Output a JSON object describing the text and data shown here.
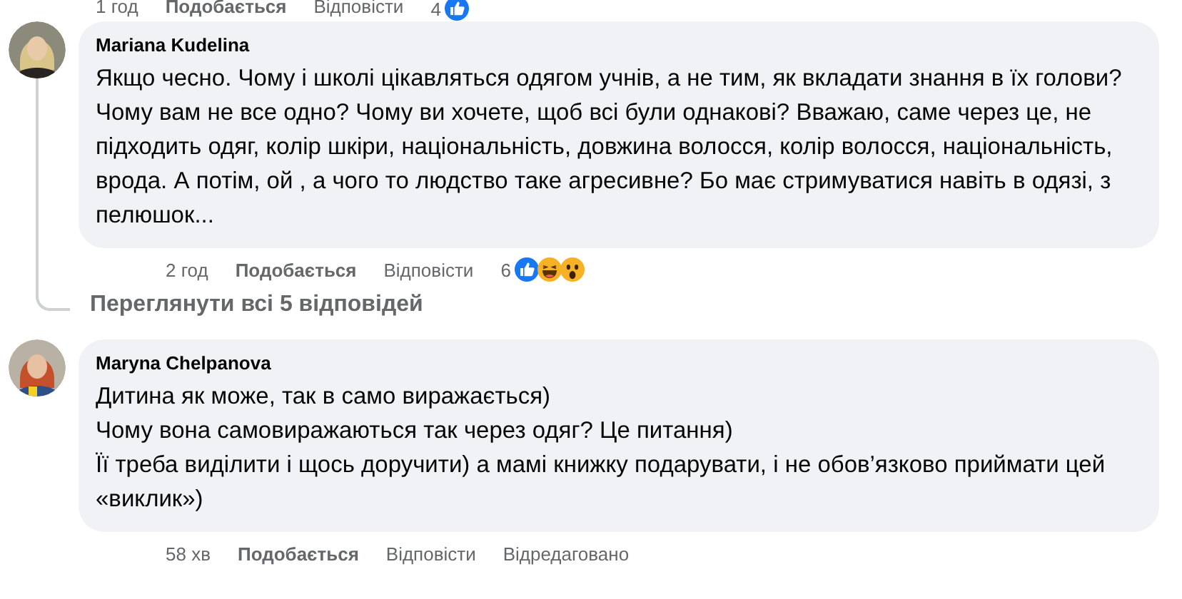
{
  "previous_actions": {
    "time": "1 год",
    "like": "Подобається",
    "reply": "Відповісти",
    "reaction_count": "4",
    "reactions": [
      {
        "kind": "like"
      }
    ]
  },
  "comments": [
    {
      "author": "Mariana Kudelina",
      "avatar": {
        "kind": "picture"
      },
      "paragraphs": [
        "Якщо чесно. Чому і школі цікавляться одягом учнів, а не тим, як вкладати знання в їх голови? Чому вам не все одно? Чому ви хочете, щоб всі були однакові? Вважаю, саме через це, не підходить одяг, колір шкіри, національність, довжина волосся, колір волосся, національність, врода. А потім, ой , а чого то людство таке агресивне? Бо має стримуватися навіть в одязі, з пелюшок..."
      ],
      "actions": {
        "time": "2 год",
        "like": "Подобається",
        "reply": "Відповісти",
        "reaction_count": "6",
        "reactions": [
          {
            "kind": "like"
          },
          {
            "kind": "haha"
          },
          {
            "kind": "wow"
          }
        ]
      },
      "view_replies": "Переглянути всі 5 відповідей"
    },
    {
      "author": "Maryna Chelpanova",
      "avatar": {
        "kind": "picture"
      },
      "paragraphs": [
        "Дитина як може, так в само виражається)",
        "Чому вона самовиражаються так через одяг? Це питання)",
        "Її треба виділити і щось доручити) а мамі книжку подарувати, і не обов’язково приймати цей «виклик»)"
      ],
      "actions": {
        "time": "58 хв",
        "like": "Подобається",
        "reply": "Відповісти",
        "edited": "Відредаговано"
      }
    }
  ]
}
